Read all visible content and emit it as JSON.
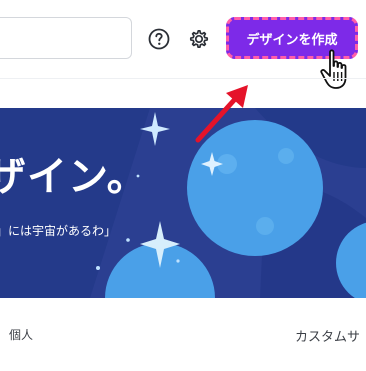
{
  "header": {
    "search": {
      "placeholder": ""
    },
    "help_icon": "question-circle-icon",
    "settings_icon": "gear-icon",
    "create_button_label": "デザインを作成",
    "colors": {
      "create_button": "#7d2ae8",
      "dashed_highlight": "#ff5ea8",
      "annotation_arrow": "#e5132a"
    }
  },
  "banner": {
    "title": "ザイン。",
    "subtitle": "」には宇宙があるわ」",
    "colors": {
      "background": "#2a3e8f",
      "planet": "#4a9fe6"
    }
  },
  "tabs": [
    {
      "label": "個人"
    },
    {
      "label": "カスタムサ"
    }
  ]
}
